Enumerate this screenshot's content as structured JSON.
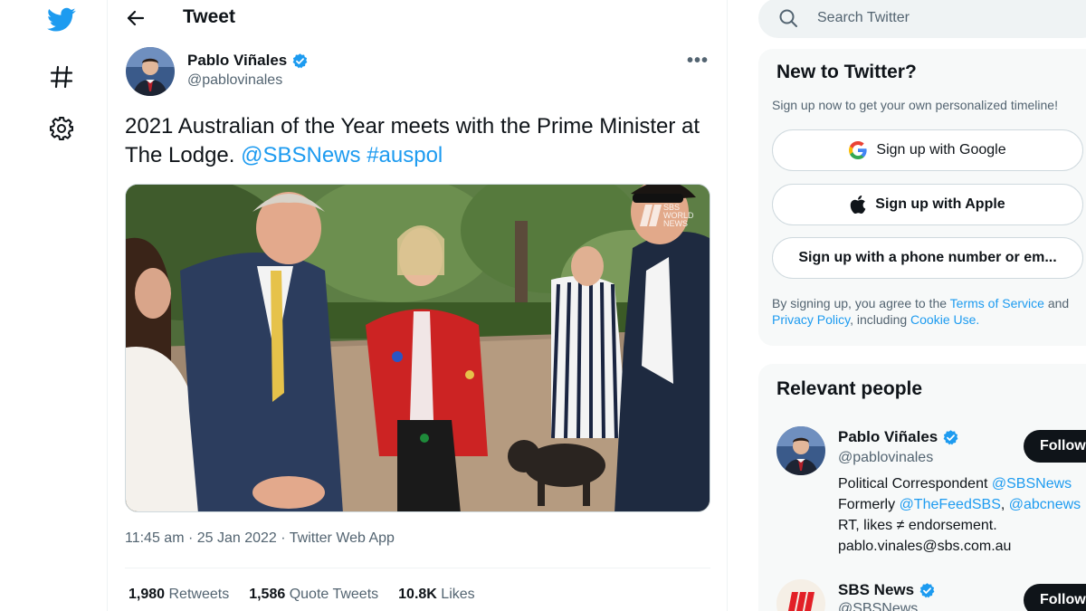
{
  "nav": {
    "icons": [
      "twitter-bird-icon",
      "hashtag-icon",
      "gear-icon"
    ]
  },
  "header": {
    "title": "Tweet"
  },
  "tweet": {
    "author_name": "Pablo Viñales",
    "author_handle": "@pablovinales",
    "text_plain": "2021 Australian of the Year meets with the Prime Minister at The Lodge.",
    "mention": "@SBSNews",
    "hashtag": "#auspol",
    "media_watermark": [
      "SBS",
      "WORLD",
      "NEWS"
    ],
    "timestamp": "11:45 am · 25 Jan 2022 · Twitter Web App",
    "retweets_count": "1,980",
    "retweets_label": "Retweets",
    "quotes_count": "1,586",
    "quotes_label": "Quote Tweets",
    "likes_count": "10.8K",
    "likes_label": "Likes"
  },
  "search": {
    "placeholder": "Search Twitter"
  },
  "new_to_twitter": {
    "title": "New to Twitter?",
    "subtitle": "Sign up now to get your own personalized timeline!",
    "google_label": "Sign up with Google",
    "apple_label": "Sign up with Apple",
    "phone_label": "Sign up with a phone number or em...",
    "terms_prefix": "By signing up, you agree to the",
    "terms_link": "Terms of Service",
    "terms_and": "and",
    "privacy_link": "Privacy Policy",
    "terms_including": ", including",
    "cookie_link": "Cookie Use."
  },
  "relevant_people": {
    "title": "Relevant people",
    "people": [
      {
        "name": "Pablo Viñales",
        "handle": "@pablovinales",
        "follow_label": "Follow",
        "bio_line1_text": "Political Correspondent",
        "bio_line1_link": "@SBSNews",
        "bio_line2_text": "Formerly",
        "bio_line2_link1": "@TheFeedSBS",
        "bio_line2_sep": ",",
        "bio_line2_link2": "@abcnews",
        "bio_line3": "RT, likes ≠ endorsement.",
        "bio_line4": "pablo.vinales@sbs.com.au"
      },
      {
        "name": "SBS News",
        "handle": "@SBSNews",
        "follow_label": "Follow"
      }
    ]
  },
  "colors": {
    "brand_blue": "#1d9bf0",
    "text_primary": "#0f1419",
    "text_secondary": "#536471"
  }
}
